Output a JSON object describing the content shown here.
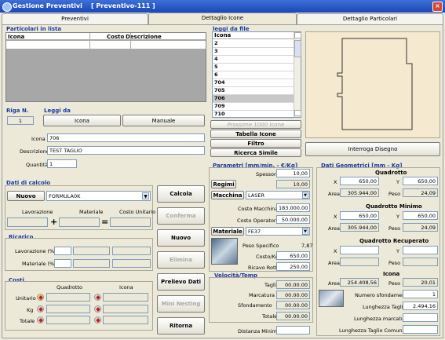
{
  "window": {
    "title": "Gestione Preventivi    [ Preventivo-111 ]",
    "close": "×"
  },
  "tabs": [
    "Preventivi",
    "Dettaglio Icone",
    "Dettaglio Particolari"
  ],
  "particolari": {
    "title": "Particolari in lista",
    "headers": [
      "Icona",
      "Costo",
      "Descrizione"
    ]
  },
  "leggi_file": {
    "title": "leggi da file",
    "header": "Icona",
    "items": [
      "2",
      "3",
      "4",
      "5",
      "6",
      "704",
      "705",
      "706",
      "709",
      "710"
    ],
    "selected": "706"
  },
  "riga": {
    "label": "Riga N.",
    "value": "1"
  },
  "leggi_da": {
    "label": "Leggi da",
    "icona_btn": "Icona",
    "manuale_btn": "Manuale"
  },
  "fields": {
    "icona_label": "Icona",
    "icona_value": "706",
    "descrizione_label": "Descrizione",
    "descrizione_value": "TEST TAGLIO",
    "quantita_label": "Quantità",
    "quantita_value": "1"
  },
  "file_buttons": [
    "Prossime 1000 Icone",
    "Tabella Icone",
    "Filtro",
    "Ricerca Simile"
  ],
  "interroga": "Interroga Disegno",
  "calcolo": {
    "title": "Dati di calcolo",
    "nuovo": "Nuovo",
    "formula": "FORMULA0K",
    "lavorazione": "Lavorazione",
    "materiale": "Materiale",
    "costo_unitario": "Costo Unitario",
    "plus": "+",
    "equals": "="
  },
  "ricarico": {
    "title": "Ricarico",
    "lavorazione": "Lavorazione (%)",
    "materiale": "Materiale (%)"
  },
  "costi": {
    "title": "Costi",
    "quadrotto": "Quadrotto",
    "icona": "Icona",
    "rows": [
      "Unitario",
      "Kg",
      "Totale"
    ]
  },
  "actions": [
    "Calcola",
    "Conferma",
    "Nuovo",
    "Elimina",
    "Prelievo Dati",
    "Mini Nesting",
    "Ritorna"
  ],
  "actions_disabled": [
    false,
    true,
    false,
    true,
    false,
    true,
    false
  ],
  "parametri": {
    "title": "Parametri [mm/min. - €/Kg]",
    "spessore_label": "Spessore",
    "spessore": "10,00",
    "regimi_btn": "Regimi",
    "regimi_value": "10,00",
    "macchina_btn": "Macchina",
    "macchina_value": "LASER",
    "costo_macchina_label": "Costo Macchina",
    "costo_macchina": "183.000,00",
    "costo_operatore_label": "Costo Operatore",
    "costo_operatore": "50.000,00",
    "materiale_btn": "Materiale",
    "materiale_value": "FE37",
    "peso_specifico_label": "Peso Specifico",
    "peso_specifico": "7,87",
    "costo_kg_label": "Costo/Kg",
    "costo_kg": "650,00",
    "ricavo_label": "Ricavo Rottame",
    "ricavo": "250,00"
  },
  "velocita": {
    "title": "Velocità/Temp",
    "rows": [
      {
        "label": "Taglio",
        "value": "00.00.00"
      },
      {
        "label": "Marcatura",
        "value": "00.00.00"
      },
      {
        "label": "Sfondamento",
        "value": "00.00.00"
      },
      {
        "label": "Totale",
        "value": "00.00.00"
      }
    ],
    "distanza_label": "Distanza Minima"
  },
  "geometrici": {
    "title": "Dati Geometrici  [mm - Kg]",
    "quadrotto": {
      "title": "Quadrotto",
      "x": "650,00",
      "y": "650,00",
      "area": "305.944,00",
      "peso": "24,09"
    },
    "quadrotto_minimo": {
      "title": "Quadrotto Minimo",
      "x": "650,00",
      "y": "650,00",
      "area": "305.944,00",
      "peso": "24,09"
    },
    "quadrotto_recuperato": {
      "title": "Quadrotto Recuperato"
    },
    "icona": {
      "title": "Icona",
      "area": "254.408,56",
      "peso": "20,01"
    },
    "x_label": "X",
    "y_label": "Y",
    "area_label": "Area",
    "peso_label": "Peso",
    "numero_label": "Numero sfondamenti",
    "numero": "1",
    "lunghezza_tagli_label": "Lunghezza Tagli",
    "lunghezza_tagli": "2.494,16",
    "lunghezza_marcatura_label": "Lunghezza marcatura",
    "lunghezza_comune_label": "Lunghezza Taglio Comune"
  }
}
